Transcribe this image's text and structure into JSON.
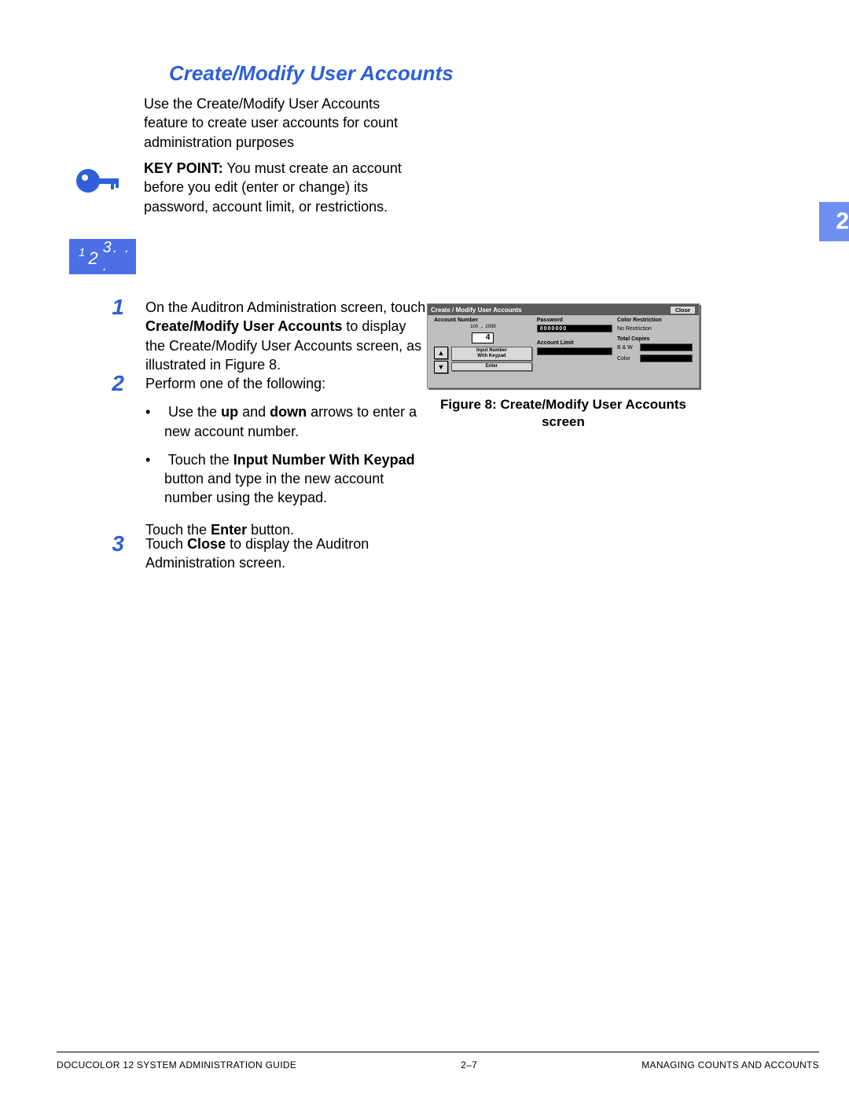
{
  "section_title": "Create/Modify User Accounts",
  "intro": "Use the Create/Modify User Accounts feature to create user accounts for count administration purposes",
  "keypoint": {
    "label": "KEY POINT:",
    "text": "You must create an account before you edit (enter or change) its password, account limit, or restrictions."
  },
  "steps_icon": {
    "one": "1",
    "two": "2",
    "rest": "3. . ."
  },
  "page_tab": "2",
  "steps": {
    "s1": {
      "num": "1",
      "pre": "On the Auditron Administration screen, touch ",
      "bold": "Create/Modify User Accounts",
      "post": " to display the Create/Modify User Accounts screen, as illustrated in Figure 8."
    },
    "s2": {
      "num": "2",
      "text": "Perform one of the following:",
      "bullet1_pre": "Use the ",
      "bullet1_b1": "up",
      "bullet1_mid": " and ",
      "bullet1_b2": "down",
      "bullet1_post": " arrows to enter a new account number.",
      "bullet2_pre": "Touch the ",
      "bullet2_b": "Input Number With Keypad",
      "bullet2_post": " button and type in the new account number using the keypad.",
      "sub_pre": "Touch the ",
      "sub_b": "Enter",
      "sub_post": " button."
    },
    "s3": {
      "num": "3",
      "pre": "Touch ",
      "bold": "Close",
      "post": " to display the Auditron Administration screen."
    }
  },
  "figure": {
    "caption": "Figure 8: Create/Modify User Accounts screen",
    "ui": {
      "title": "Create / Modify User Accounts",
      "close": "Close",
      "acct_label": "Account Number",
      "acct_range": "100 → 2099",
      "acct_value": "4",
      "input_btn": "Input Number\nWith Keypad",
      "enter_btn": "Enter",
      "password_label": "Password",
      "password_value": "0000000",
      "acct_limit_label": "Account Limit",
      "color_restrict_label": "Color Restriction",
      "color_restrict_value": "No Restriction",
      "total_copies_label": "Total Copies",
      "bw_label": "B & W",
      "color_label": "Color"
    }
  },
  "footer": {
    "left": "DOCUCOLOR 12 SYSTEM ADMINISTRATION GUIDE",
    "center": "2–7",
    "right": "MANAGING COUNTS AND ACCOUNTS"
  }
}
